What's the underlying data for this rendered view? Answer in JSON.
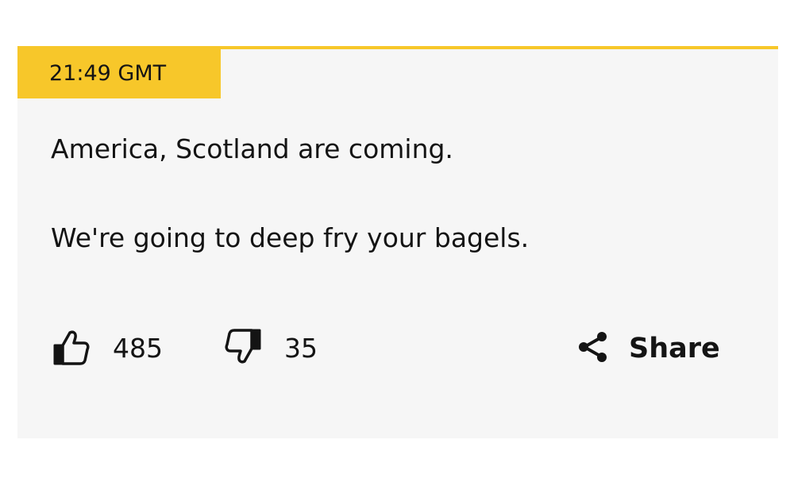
{
  "post": {
    "timestamp": "21:49 GMT",
    "lines": [
      "America, Scotland are coming.",
      "We're going to deep fry your bagels."
    ]
  },
  "actions": {
    "like_icon": "thumbs-up-icon",
    "like_count": "485",
    "dislike_icon": "thumbs-down-icon",
    "dislike_count": "35",
    "share_icon": "share-icon",
    "share_label": "Share"
  },
  "colors": {
    "accent": "#f7c72a",
    "card_background": "#f6f6f6",
    "text": "#141414"
  }
}
